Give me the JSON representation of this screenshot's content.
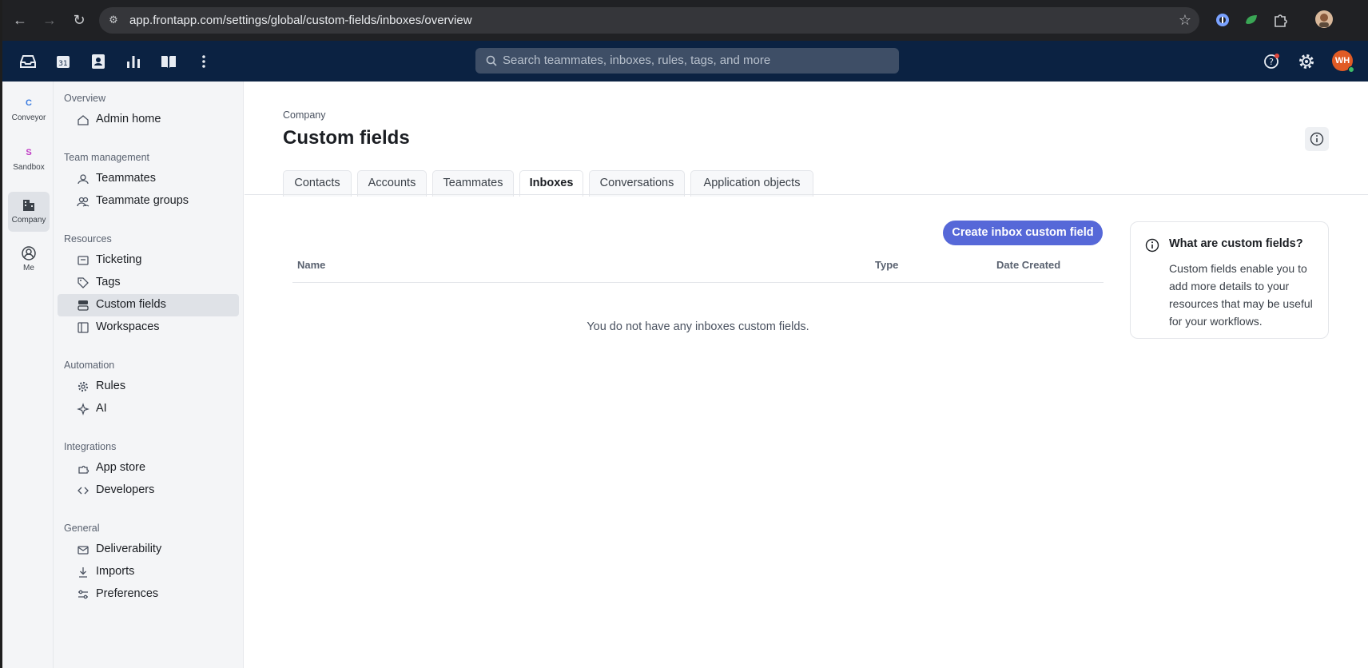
{
  "browser": {
    "url": "app.frontapp.com/settings/global/custom-fields/inboxes/overview"
  },
  "app_bar": {
    "search_placeholder": "Search teammates, inboxes, rules, tags, and more",
    "avatar_initials": "WH"
  },
  "rail": {
    "items": [
      {
        "badge": "C",
        "label": "Conveyor",
        "color": "#3c7ce0"
      },
      {
        "badge": "S",
        "label": "Sandbox",
        "color": "#c03ac4"
      },
      {
        "badge": "",
        "label": "Company",
        "color": "#3b4149"
      },
      {
        "badge": "",
        "label": "Me",
        "color": "#3b4149"
      }
    ]
  },
  "sidebar": {
    "sections": [
      {
        "title": "Overview",
        "items": [
          "Admin home"
        ]
      },
      {
        "title": "Team management",
        "items": [
          "Teammates",
          "Teammate groups"
        ]
      },
      {
        "title": "Resources",
        "items": [
          "Ticketing",
          "Tags",
          "Custom fields",
          "Workspaces"
        ]
      },
      {
        "title": "Automation",
        "items": [
          "Rules",
          "AI"
        ]
      },
      {
        "title": "Integrations",
        "items": [
          "App store",
          "Developers"
        ]
      },
      {
        "title": "General",
        "items": [
          "Deliverability",
          "Imports",
          "Preferences"
        ]
      }
    ],
    "active_item": "Custom fields"
  },
  "main": {
    "breadcrumb": "Company",
    "title": "Custom fields",
    "tabs": [
      "Contacts",
      "Accounts",
      "Teammates",
      "Inboxes",
      "Conversations",
      "Application objects"
    ],
    "active_tab": "Inboxes",
    "create_button": "Create inbox custom field",
    "columns": [
      "Name",
      "Type",
      "Date Created"
    ],
    "empty_message": "You do not have any inboxes custom fields."
  },
  "help_card": {
    "title": "What are custom fields?",
    "body": "Custom fields enable you to add more details to your resources that may be useful for your workflows."
  },
  "colors": {
    "app_bar": "#0b2242",
    "accent": "#5668d8",
    "avatar": "#e05b25"
  }
}
